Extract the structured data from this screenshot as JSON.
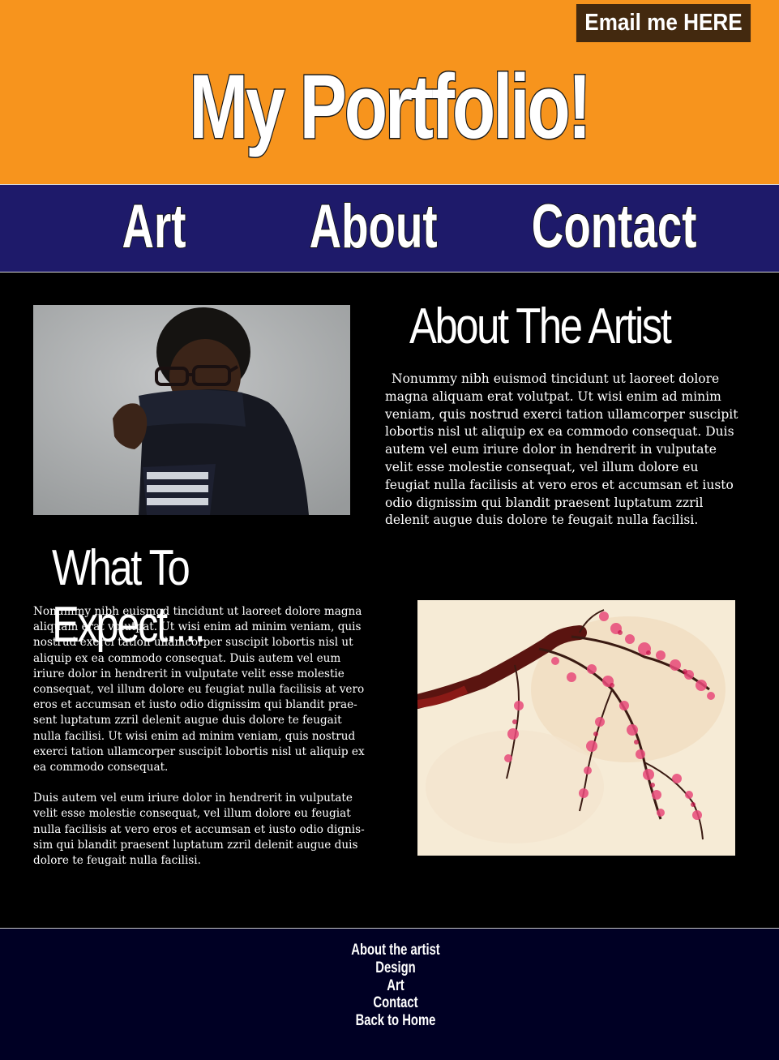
{
  "header": {
    "email_button": "Email me HERE",
    "title": "My Portfolio!"
  },
  "nav": {
    "items": [
      {
        "label": "Art"
      },
      {
        "label": "About"
      },
      {
        "label": "Contact"
      }
    ]
  },
  "about": {
    "heading": "About The Artist",
    "text": "Nonummy nibh euismod tincidunt ut laoreet dolore magna aliquam erat volutpat. Ut wisi enim ad minim veniam, quis nostrud exerci tation ullamcorper suscipit lobortis nisl ut aliquip ex ea commodo consequat. Duis autem vel eum iriure dolor in hendrerit in vulputate velit esse molestie consequat, vel illum dolore eu feugiat nulla facilisis at vero eros et accumsan et iusto odio dignissim qui blandit praesent luptatum zzril delenit augue duis dolore te feugait nulla facilisi."
  },
  "expect": {
    "heading": "What To Expect....",
    "paragraph1": "Nonummy nibh euismod tincidunt ut laoreet dolore magna aliquam erat volutpat. Ut wisi enim ad minim veniam, quis nostrud exerci tation ullamcorper suscipit lobortis nisl ut aliquip ex ea commodo consequat. Duis autem vel eum iriure dolor in hendrerit in vulputate velit esse molestie consequat, vel illum dolore eu feugiat nulla facilisis at vero eros et accumsan et iusto odio dignissim qui blandit prae-sent luptatum zzril delenit augue duis dolore te feugait nulla facilisi. Ut wisi enim ad minim veniam, quis nostrud exerci tation ullamcorper suscipit lobortis nisl ut aliquip ex ea commodo consequat.",
    "paragraph2": "Duis autem vel eum iriure dolor in hendrerit in vulputate velit esse molestie consequat, vel illum dolore eu feugiat nulla facilisis at vero eros et accumsan et iusto odio dignis-sim qui blandit praesent luptatum zzril delenit augue duis dolore te feugait nulla facilisi."
  },
  "footer": {
    "links": [
      {
        "label": "About the artist"
      },
      {
        "label": "Design"
      },
      {
        "label": "Art"
      },
      {
        "label": "Contact"
      },
      {
        "label": "Back to Home"
      }
    ]
  },
  "colors": {
    "header_bg": "#f7941d",
    "email_btn_bg": "#43290f",
    "nav_bg": "#1e1a6a",
    "main_bg": "#000000",
    "footer_bg": "#000024"
  }
}
